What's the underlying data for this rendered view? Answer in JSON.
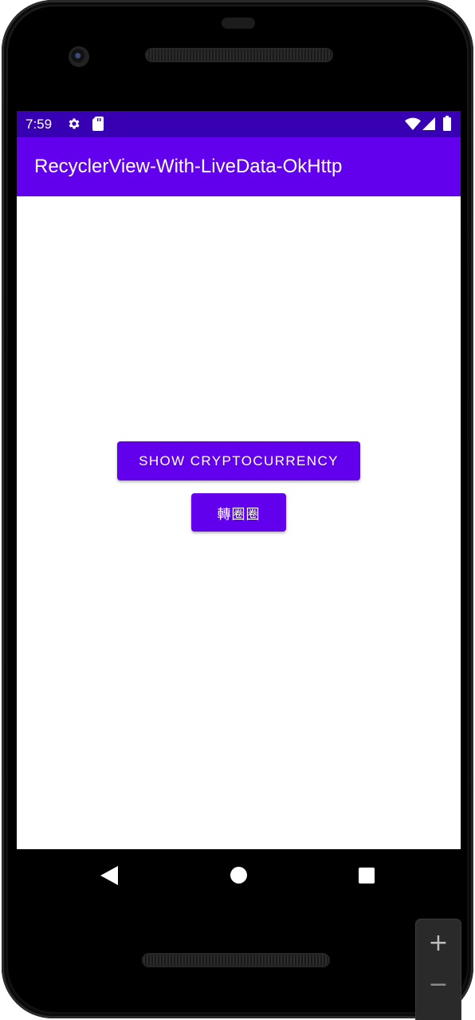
{
  "status_bar": {
    "time": "7:59",
    "icons": [
      "gear-icon",
      "sd-card-icon",
      "wifi-icon",
      "signal-icon",
      "battery-icon"
    ],
    "background": "#3700b3"
  },
  "app_bar": {
    "title": "RecyclerView-With-LiveData-OkHttp",
    "background": "#6200ee"
  },
  "main": {
    "buttons": [
      {
        "label": "SHOW CRYPTOCURRENCY"
      },
      {
        "label": "轉圈圈"
      }
    ],
    "accent": "#6200ee"
  },
  "nav_bar": {
    "icons": [
      "back-icon",
      "home-icon",
      "recents-icon"
    ]
  },
  "emulator_controls": {
    "zoom_in": "+",
    "zoom_out": "−"
  }
}
